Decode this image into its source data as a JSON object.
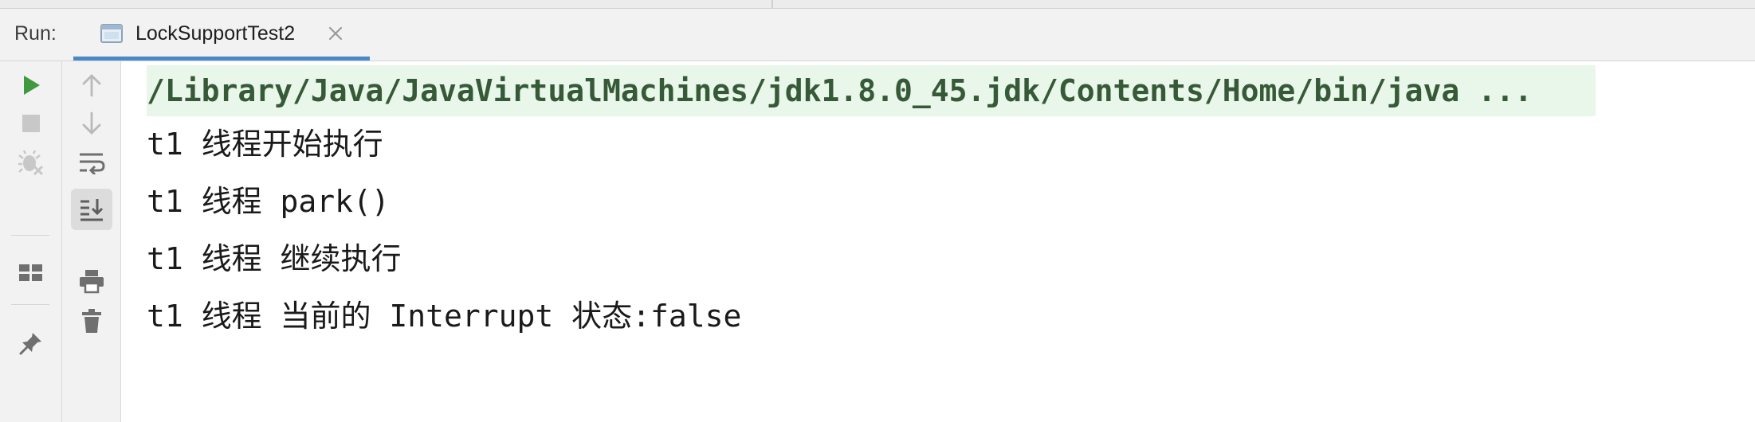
{
  "run_panel": {
    "label": "Run:",
    "tab": {
      "title": "LockSupportTest2",
      "icon": "application-run-config-icon",
      "close_icon": "close-icon"
    }
  },
  "left_toolbar": {
    "items": [
      {
        "name": "rerun-icon",
        "color": "#3f9a3f"
      },
      {
        "name": "stop-icon",
        "color": "#c8c8c8"
      },
      {
        "name": "debug-disabled-icon",
        "color": "#c8c8c8"
      },
      {
        "name": "layout-icon",
        "color": "#6f6f6f"
      },
      {
        "name": "pin-icon",
        "color": "#6f6f6f"
      }
    ]
  },
  "right_toolbar": {
    "items": [
      {
        "name": "arrow-up-icon"
      },
      {
        "name": "arrow-down-icon"
      },
      {
        "name": "soft-wrap-icon"
      },
      {
        "name": "scroll-to-end-icon",
        "active": true
      },
      {
        "name": "print-icon"
      },
      {
        "name": "trash-icon"
      }
    ]
  },
  "console": {
    "command": "/Library/Java/JavaVirtualMachines/jdk1.8.0_45.jdk/Contents/Home/bin/java ...",
    "lines": [
      "t1 线程开始执行",
      "t1 线程 park()",
      "t1 线程 继续执行",
      "t1 线程 当前的 Interrupt 状态:false"
    ]
  },
  "colors": {
    "accent_tab_underline": "#4a88c7",
    "command_highlight_bg": "#e9f6ea",
    "command_text": "#365a38"
  }
}
